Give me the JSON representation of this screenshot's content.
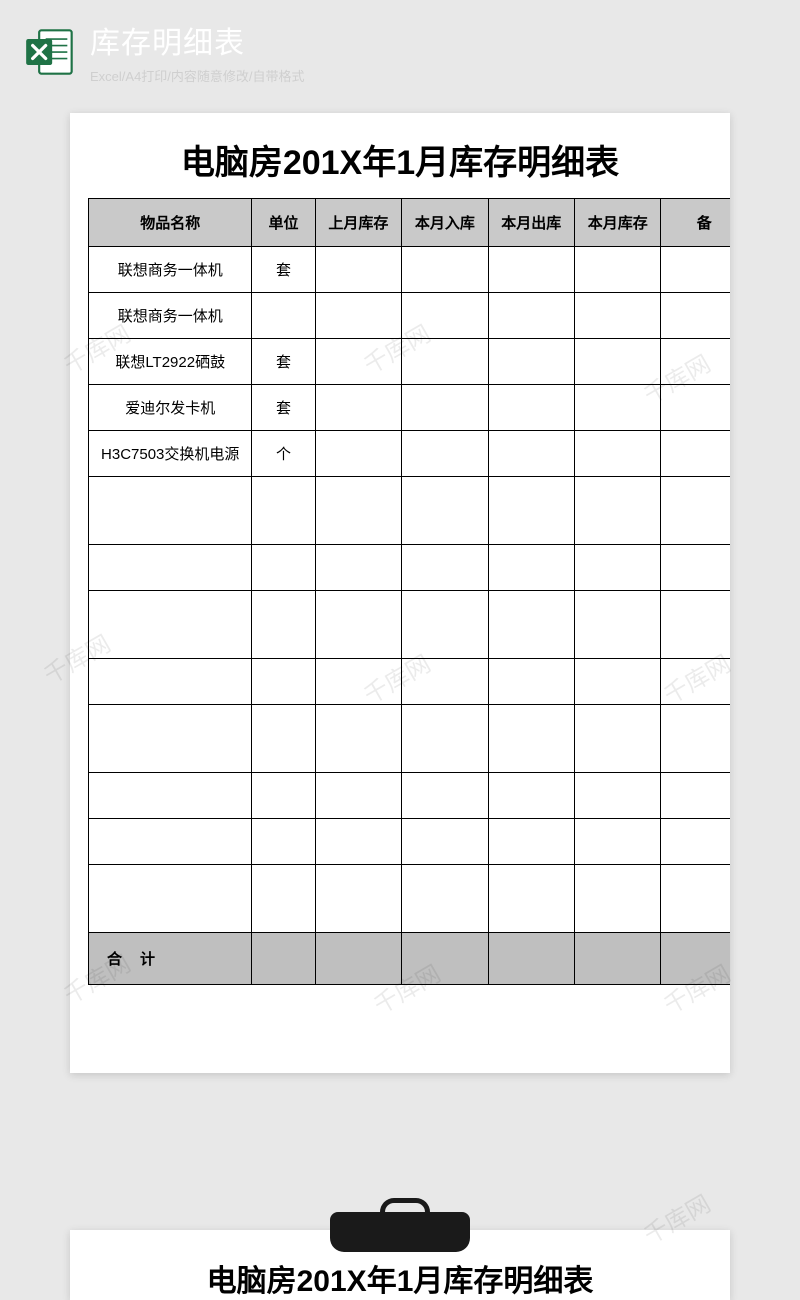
{
  "header": {
    "title": "库存明细表",
    "subtitle": "Excel/A4打印/内容随意修改/自带格式"
  },
  "document": {
    "title": "电脑房201X年1月库存明细表",
    "columns": [
      "物品名称",
      "单位",
      "上月库存",
      "本月入库",
      "本月出库",
      "本月库存",
      "备"
    ],
    "rows": [
      {
        "name": "联想商务一体机",
        "unit": "套"
      },
      {
        "name": "联想商务一体机",
        "unit": ""
      },
      {
        "name": "联想LT2922硒鼓",
        "unit": "套"
      },
      {
        "name": "爱迪尔发卡机",
        "unit": "套"
      },
      {
        "name": "H3C7503交换机电源",
        "unit": "个"
      },
      {
        "name": "",
        "unit": ""
      },
      {
        "name": "",
        "unit": ""
      },
      {
        "name": "",
        "unit": ""
      },
      {
        "name": "",
        "unit": ""
      },
      {
        "name": "",
        "unit": ""
      },
      {
        "name": "",
        "unit": ""
      },
      {
        "name": "",
        "unit": ""
      },
      {
        "name": "",
        "unit": ""
      }
    ],
    "tall_rows": [
      5,
      7,
      9,
      12
    ],
    "total_label": "合计"
  },
  "watermark_text": "千库网",
  "second_preview_title": "电脑房201X年1月库存明细表"
}
